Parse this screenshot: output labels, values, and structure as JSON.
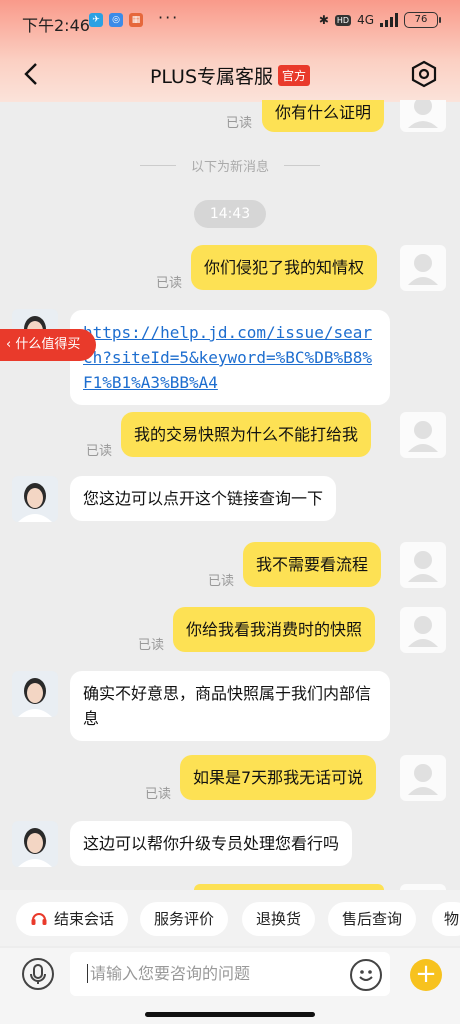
{
  "status_bar": {
    "time": "下午2:46",
    "dots": "···",
    "battery": "76",
    "network": "4G"
  },
  "header": {
    "title": "PLUS专属客服",
    "badge": "官方"
  },
  "divider_text": "以下为新消息",
  "time_chip": "14:43",
  "read_label": "已读",
  "float_tag": "‹ 什么值得买",
  "messages": [
    {
      "text": "你有什么证明"
    },
    {
      "text": "你们侵犯了我的知情权"
    },
    {
      "text": "https://help.jd.com/issue/search?siteId=5&keyword=%BC%DB%B8%F1%B1%A3%BB%A4"
    },
    {
      "text": "我的交易快照为什么不能打给我"
    },
    {
      "text": "您这边可以点开这个链接查询一下"
    },
    {
      "text": "我不需要看流程"
    },
    {
      "text": "你给我看我消费时的快照"
    },
    {
      "text": "确实不好意思，商品快照属于我们内部信息"
    },
    {
      "text": "如果是7天那我无话可说"
    },
    {
      "text": "这边可以帮你升级专员处理您看行吗"
    }
  ],
  "quick_actions": [
    "结束会话",
    "服务评价",
    "退换货",
    "售后查询",
    "物"
  ],
  "input": {
    "placeholder": "请输入您要咨询的问题"
  }
}
